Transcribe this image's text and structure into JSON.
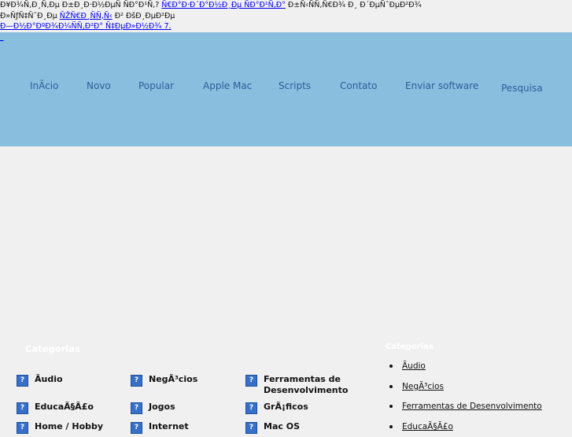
{
  "notice": {
    "line1_text": "Ð¥Ð¾Ñ‚Ð¸Ñ‚Ðµ Ð±Ð¸Ð·Ð½ÐµÑ ÑÐ°Ð¹Ñ‚? ",
    "line1_link": "Ñ€Ð°Ð·Ð´Ð°Ð½Ð¸Ðµ ÑÐ°Ð¹Ñ‚Ð°",
    "line1_after": " Ð±Ñ‹ÑÑ‚Ñ€Ð¾ Ð¸ Ð´ÐµÑˆÐµÐ²Ð¾",
    "line2_text": "Ð»ÑƒÑ‡ÑˆÐ¸Ðµ ",
    "line2_link": "ÑŽÑ€Ð¸ÑÑ‚Ñ‹",
    "line2_after": " Ð² ÐšÐ¸ÐµÐ²Ðµ",
    "line3_link": "Ð—Ð½Ð°ÐºÐ¾Ð¼ÑÑ‚Ð²Ð° Ñ‡ÐµÐ»Ð½Ð¾ 7.",
    "tiny_link": "_"
  },
  "nav": {
    "items": [
      "InÃcio",
      "Novo",
      "Popular",
      "Apple Mac",
      "Scripts",
      "Contato",
      "Enviar software",
      "Pesquisa"
    ]
  },
  "categories": {
    "title": "Categorias",
    "icon": "question-icon",
    "items": [
      "Ãudio",
      "NegÃ³cios",
      "Ferramentas de Desenvolvimento",
      "EducaÃ§Ã£o",
      "Jogos",
      "GrÃ¡ficos",
      "Home / Hobby",
      "Internet",
      "Mac OS"
    ]
  },
  "sidebar": {
    "title": "Categorias",
    "items": [
      "Ãudio",
      "NegÃ³cios",
      "Ferramentas de Desenvolvimento",
      "EducaÃ§Ã£o"
    ]
  },
  "colors": {
    "navbar": "#8abedf",
    "background": "#f0f0f0",
    "link": "#0000ee",
    "icon": "#3770c8"
  }
}
